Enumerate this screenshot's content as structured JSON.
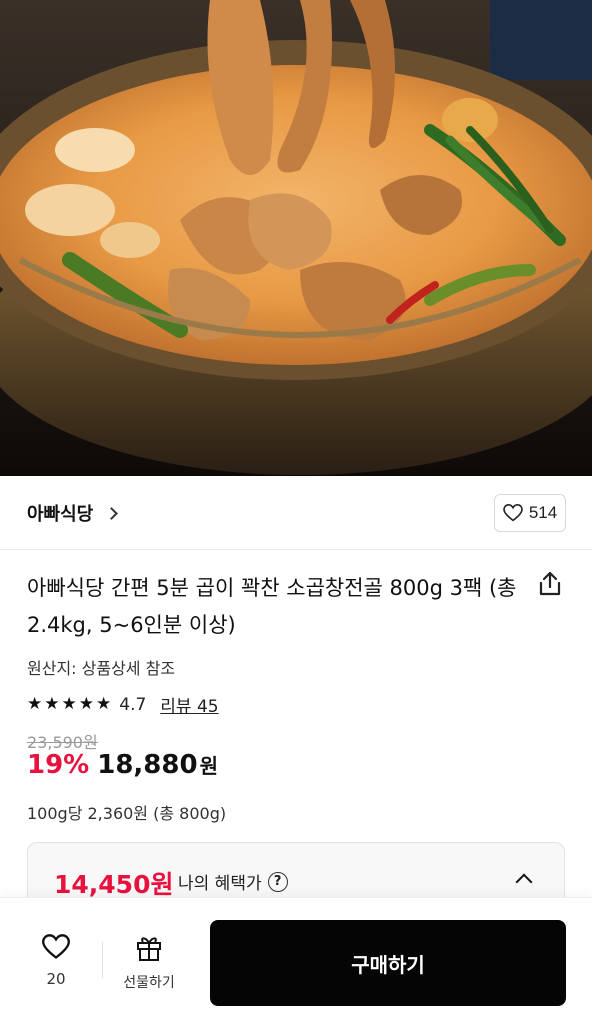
{
  "store": {
    "name": "아빠식당",
    "like_count": "514"
  },
  "product": {
    "title": "아빠식당 간편 5분 곱이 꽉찬 소곱창전골 800g 3팩 (총 2.4kg, 5~6인분 이상)",
    "origin": "원산지: 상품상세 참조",
    "rating": "4.7",
    "rating_stars": 4.7,
    "review_link": "리뷰 45",
    "original_price": "23,590원",
    "discount": "19%",
    "price": "18,880",
    "price_unit": "원",
    "unit_price": "100g당 2,360원 (총 800g)"
  },
  "benefit": {
    "price": "14,450원",
    "label": "나의 혜택가",
    "help_glyph": "?"
  },
  "bottom_bar": {
    "wish_count": "20",
    "gift_label": "선물하기",
    "buy_label": "구매하기"
  },
  "icons": [
    "chevron-right-icon",
    "heart-icon",
    "share-icon",
    "star-icon",
    "help-icon",
    "chevron-up-icon",
    "gift-icon"
  ],
  "colors": {
    "accent_red": "#e8123f",
    "buy_button": "#050505"
  }
}
